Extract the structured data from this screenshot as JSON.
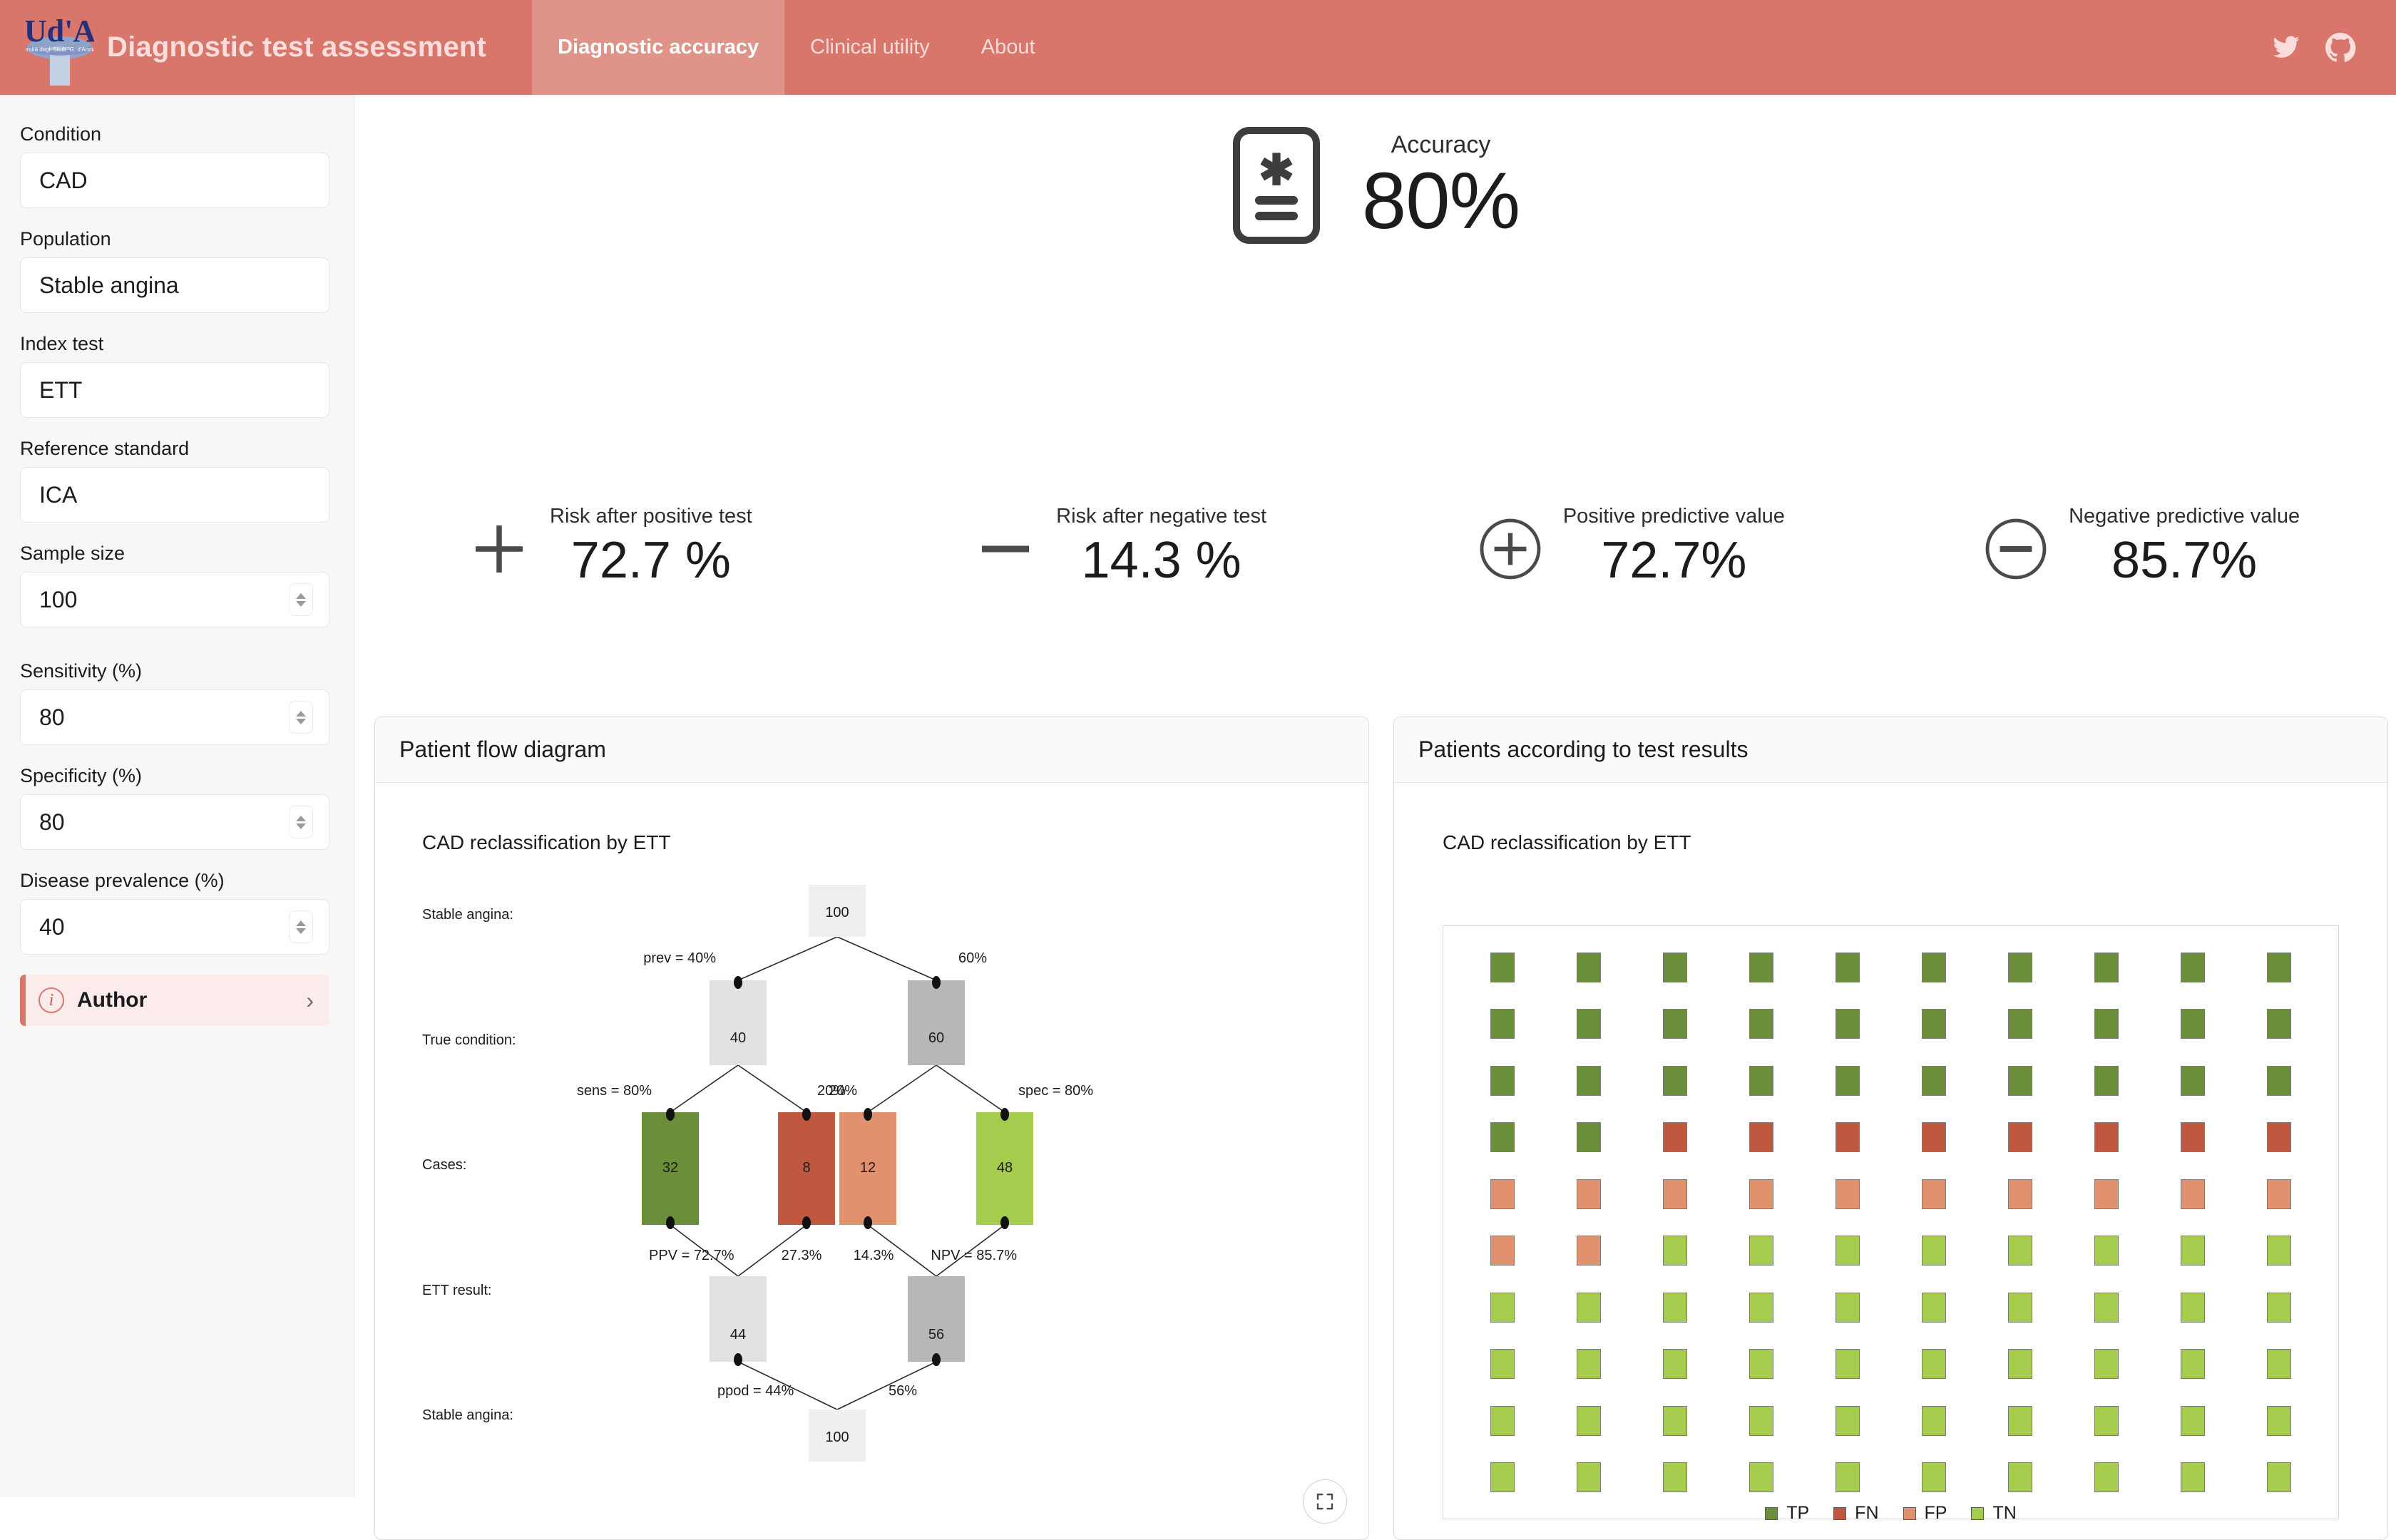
{
  "header": {
    "brand_title": "Diagnostic test assessment",
    "logo_alt": "University logo Ud'A",
    "tabs": [
      {
        "label": "Diagnostic accuracy",
        "active": true
      },
      {
        "label": "Clinical utility",
        "active": false
      },
      {
        "label": "About",
        "active": false
      }
    ],
    "social": [
      {
        "name": "twitter-icon"
      },
      {
        "name": "github-icon"
      }
    ],
    "bg_color": "#d9766b",
    "active_tab_color": "#e09389"
  },
  "sidebar": {
    "collapse_icon": "chevron-left-icon",
    "fields": [
      {
        "label": "Condition",
        "value": "CAD",
        "stepper": false
      },
      {
        "label": "Population",
        "value": "Stable angina",
        "stepper": false
      },
      {
        "label": "Index test",
        "value": "ETT",
        "stepper": false
      },
      {
        "label": "Reference standard",
        "value": "ICA",
        "stepper": false
      },
      {
        "label": "Sample size",
        "value": "100",
        "stepper": true
      },
      {
        "label": "Sensitivity (%)",
        "value": "80",
        "stepper": true
      },
      {
        "label": "Specificity (%)",
        "value": "80",
        "stepper": true
      },
      {
        "label": "Disease prevalence (%)",
        "value": "40",
        "stepper": true
      }
    ],
    "author": {
      "label": "Author",
      "info_icon": "info-icon",
      "chevron": "chevron-right-icon"
    }
  },
  "metrics": {
    "accuracy": {
      "label": "Accuracy",
      "value": "80%",
      "icon": "test-report-icon"
    },
    "row": [
      {
        "label": "Risk after positive test",
        "value": "72.7 %",
        "icon": "plus-icon"
      },
      {
        "label": "Risk after negative test",
        "value": "14.3 %",
        "icon": "minus-icon"
      },
      {
        "label": "Positive predictive value",
        "value": "72.7%",
        "icon": "plus-circle-icon"
      },
      {
        "label": "Negative predictive value",
        "value": "85.7%",
        "icon": "minus-circle-icon"
      }
    ]
  },
  "panel_flow": {
    "title": "Patient flow diagram",
    "expand_icon": "expand-icon",
    "chart_data": {
      "type": "diagram",
      "title": "CAD reclassification by ETT",
      "row_labels": [
        "Stable angina:",
        "True condition:",
        "Cases:",
        "ETT result:",
        "Stable angina:"
      ],
      "nodes": {
        "top_total": "100",
        "true_positive_pool": "40",
        "true_negative_pool": "60",
        "tp": "32",
        "fn": "8",
        "fp": "12",
        "tn": "48",
        "test_positive": "44",
        "test_negative": "56",
        "bottom_total": "100"
      },
      "edge_labels": {
        "prev": "prev = 40%",
        "prev_complement": "60%",
        "sens": "sens = 80%",
        "sens_complement": "20%",
        "spec_complement": "20%",
        "spec": "spec = 80%",
        "ppv": "PPV = 72.7%",
        "ppv_complement": "27.3%",
        "npv_complement": "14.3%",
        "npv": "NPV = 85.7%",
        "ppod": "ppod = 44%",
        "ppod_complement": "56%"
      },
      "colors": {
        "tp": "#6b8e3a",
        "fn": "#c0583f",
        "fp": "#e2916f",
        "tn": "#a6cc4e",
        "neutral_light": "#efefef",
        "neutral_mid": "#e2e2e2",
        "neutral_dark": "#b7b7b7"
      }
    }
  },
  "panel_waffle": {
    "title": "Patients according to test results",
    "chart_data": {
      "type": "waffle",
      "title": "CAD reclassification by ETT",
      "rows": 10,
      "columns": 10,
      "legend_position": "bottom",
      "categories": [
        {
          "key": "TP",
          "label": "TP",
          "count": 32,
          "color": "#6b8e3a"
        },
        {
          "key": "FN",
          "label": "FN",
          "count": 8,
          "color": "#c0583f"
        },
        {
          "key": "FP",
          "label": "FP",
          "count": 12,
          "color": "#e2916f"
        },
        {
          "key": "TN",
          "label": "TN",
          "count": 48,
          "color": "#a6cc4e"
        }
      ],
      "cells": [
        "TP",
        "TP",
        "TP",
        "TP",
        "TP",
        "TP",
        "TP",
        "TP",
        "TP",
        "TP",
        "TP",
        "TP",
        "TP",
        "TP",
        "TP",
        "TP",
        "TP",
        "TP",
        "TP",
        "TP",
        "TP",
        "TP",
        "TP",
        "TP",
        "TP",
        "TP",
        "TP",
        "TP",
        "TP",
        "TP",
        "TP",
        "TP",
        "FN",
        "FN",
        "FN",
        "FN",
        "FN",
        "FN",
        "FN",
        "FN",
        "FP",
        "FP",
        "FP",
        "FP",
        "FP",
        "FP",
        "FP",
        "FP",
        "FP",
        "FP",
        "FP",
        "FP",
        "TN",
        "TN",
        "TN",
        "TN",
        "TN",
        "TN",
        "TN",
        "TN",
        "TN",
        "TN",
        "TN",
        "TN",
        "TN",
        "TN",
        "TN",
        "TN",
        "TN",
        "TN",
        "TN",
        "TN",
        "TN",
        "TN",
        "TN",
        "TN",
        "TN",
        "TN",
        "TN",
        "TN",
        "TN",
        "TN",
        "TN",
        "TN",
        "TN",
        "TN",
        "TN",
        "TN",
        "TN",
        "TN",
        "TN",
        "TN",
        "TN",
        "TN",
        "TN",
        "TN",
        "TN",
        "TN",
        "TN",
        "TN"
      ]
    }
  }
}
